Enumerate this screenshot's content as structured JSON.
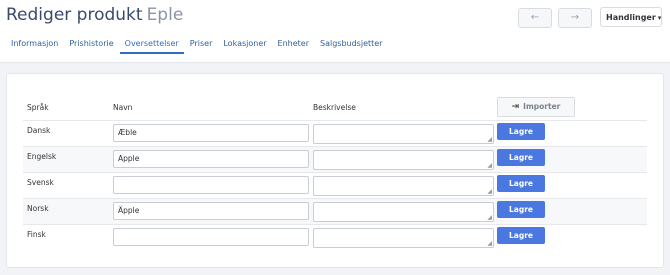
{
  "header": {
    "title": "Rediger produkt",
    "subtitle": "Eple",
    "prev_icon": "←",
    "next_icon": "→",
    "actions_label": "Handlinger",
    "actions_chevron": "▾"
  },
  "tabs": [
    {
      "label": "Informasjon",
      "active": false
    },
    {
      "label": "Prishistorie",
      "active": false
    },
    {
      "label": "Oversettelser",
      "active": true
    },
    {
      "label": "Priser",
      "active": false
    },
    {
      "label": "Lokasjoner",
      "active": false
    },
    {
      "label": "Enheter",
      "active": false
    },
    {
      "label": "Salgsbudsjetter",
      "active": false
    }
  ],
  "table": {
    "col_language": "Språk",
    "col_name": "Navn",
    "col_description": "Beskrivelse",
    "import_label": "Importer",
    "import_icon": "⇥",
    "save_label": "Lagre",
    "rows": [
      {
        "language": "Dansk",
        "name": "Æble",
        "description": ""
      },
      {
        "language": "Engelsk",
        "name": "Apple",
        "description": ""
      },
      {
        "language": "Svensk",
        "name": "",
        "description": ""
      },
      {
        "language": "Norsk",
        "name": "Äpple",
        "description": ""
      },
      {
        "language": "Finsk",
        "name": "",
        "description": ""
      }
    ]
  },
  "colors": {
    "accent": "#4a77e0",
    "tab_active": "#2f6fc2",
    "title": "#3a4a6b"
  }
}
